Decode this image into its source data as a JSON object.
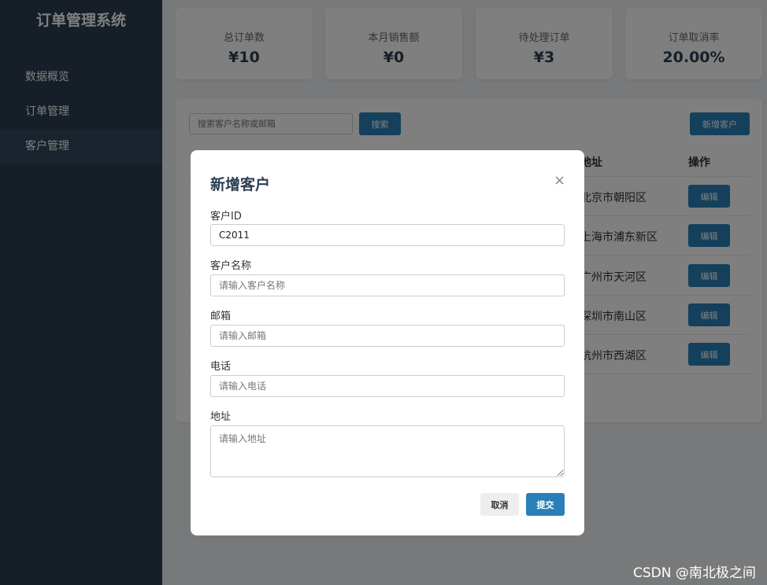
{
  "sidebar": {
    "title": "订单管理系统",
    "items": [
      {
        "label": "数据概览",
        "active": false
      },
      {
        "label": "订单管理",
        "active": false
      },
      {
        "label": "客户管理",
        "active": true
      }
    ]
  },
  "stats": [
    {
      "label": "总订单数",
      "value": "¥10"
    },
    {
      "label": "本月销售额",
      "value": "¥0"
    },
    {
      "label": "待处理订单",
      "value": "¥3"
    },
    {
      "label": "订单取消率",
      "value": "20.00%"
    }
  ],
  "customer_panel": {
    "search_placeholder": "搜索客户名称或邮箱",
    "search_label": "搜索",
    "add_label": "新增客户",
    "columns": {
      "address": "地址",
      "actions": "操作"
    },
    "rows": [
      {
        "address": "北京市朝阳区",
        "action": "编辑"
      },
      {
        "address": "上海市浦东新区",
        "action": "编辑"
      },
      {
        "address": "广州市天河区",
        "action": "编辑"
      },
      {
        "address": "深圳市南山区",
        "action": "编辑"
      },
      {
        "address": "杭州市西湖区",
        "action": "编辑"
      }
    ]
  },
  "modal": {
    "title": "新增客户",
    "close_icon": "×",
    "fields": {
      "id": {
        "label": "客户ID",
        "value": "C2011"
      },
      "name": {
        "label": "客户名称",
        "placeholder": "请输入客户名称"
      },
      "email": {
        "label": "邮箱",
        "placeholder": "请输入邮箱"
      },
      "phone": {
        "label": "电话",
        "placeholder": "请输入电话"
      },
      "address": {
        "label": "地址",
        "placeholder": "请输入地址"
      }
    },
    "cancel_label": "取消",
    "submit_label": "提交"
  },
  "watermark": "CSDN @南北极之间",
  "colors": {
    "sidebar": "#2c3e50",
    "primary": "#2980b9",
    "overlay": "rgba(0,0,0,0.5)"
  }
}
